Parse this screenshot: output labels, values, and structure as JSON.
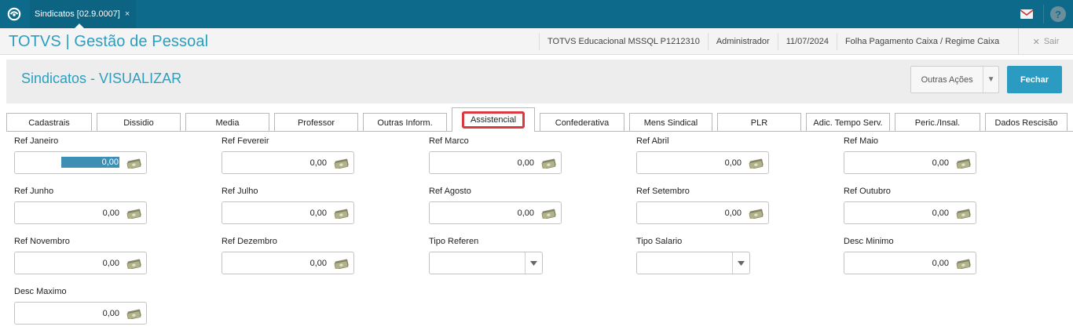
{
  "topbar": {
    "tab_label": "Sindicatos [02.9.0007]",
    "tab_close": "×",
    "logo_icon": "totvs-logo-icon",
    "mail_icon": "mail-icon",
    "help_icon": "help-icon",
    "help_glyph": "?"
  },
  "header": {
    "app_title": "TOTVS | Gestão de Pessoal",
    "environment": "TOTVS Educacional MSSQL P1212310",
    "user": "Administrador",
    "date": "11/07/2024",
    "branch": "Folha Pagamento Caixa / Regime Caixa",
    "exit_label": "Sair",
    "exit_glyph": "✕"
  },
  "page": {
    "title": "Sindicatos - VISUALIZAR",
    "other_actions_label": "Outras Ações",
    "close_label": "Fechar"
  },
  "tabs": [
    {
      "label": "Cadastrais"
    },
    {
      "label": "Dissidio"
    },
    {
      "label": "Media"
    },
    {
      "label": "Professor"
    },
    {
      "label": "Outras Inform."
    },
    {
      "label": "Assistencial",
      "active": true
    },
    {
      "label": "Confederativa"
    },
    {
      "label": "Mens Sindical"
    },
    {
      "label": "PLR"
    },
    {
      "label": "Adic. Tempo Serv."
    },
    {
      "label": "Peric./Insal."
    },
    {
      "label": "Dados Rescisão"
    }
  ],
  "fields": {
    "ref_janeiro": {
      "label": "Ref Janeiro",
      "value": "0,00"
    },
    "ref_fevereiro": {
      "label": "Ref Fevereir",
      "value": "0,00"
    },
    "ref_marco": {
      "label": "Ref Marco",
      "value": "0,00"
    },
    "ref_abril": {
      "label": "Ref Abril",
      "value": "0,00"
    },
    "ref_maio": {
      "label": "Ref Maio",
      "value": "0,00"
    },
    "ref_junho": {
      "label": "Ref Junho",
      "value": "0,00"
    },
    "ref_julho": {
      "label": "Ref Julho",
      "value": "0,00"
    },
    "ref_agosto": {
      "label": "Ref Agosto",
      "value": "0,00"
    },
    "ref_setembro": {
      "label": "Ref Setembro",
      "value": "0,00"
    },
    "ref_outubro": {
      "label": "Ref Outubro",
      "value": "0,00"
    },
    "ref_novembro": {
      "label": "Ref Novembro",
      "value": "0,00"
    },
    "ref_dezembro": {
      "label": "Ref Dezembro",
      "value": "0,00"
    },
    "tipo_referen": {
      "label": "Tipo Referen",
      "value": ""
    },
    "tipo_salario": {
      "label": "Tipo Salario",
      "value": ""
    },
    "desc_minimo": {
      "label": "Desc Minimo",
      "value": "0,00"
    },
    "desc_maximo": {
      "label": "Desc Maximo",
      "value": "0,00"
    }
  },
  "colors": {
    "topbar": "#0e6a8a",
    "accent": "#2a9fc2",
    "primary_button": "#2b9bc1",
    "active_tab_highlight": "#d9393f"
  }
}
